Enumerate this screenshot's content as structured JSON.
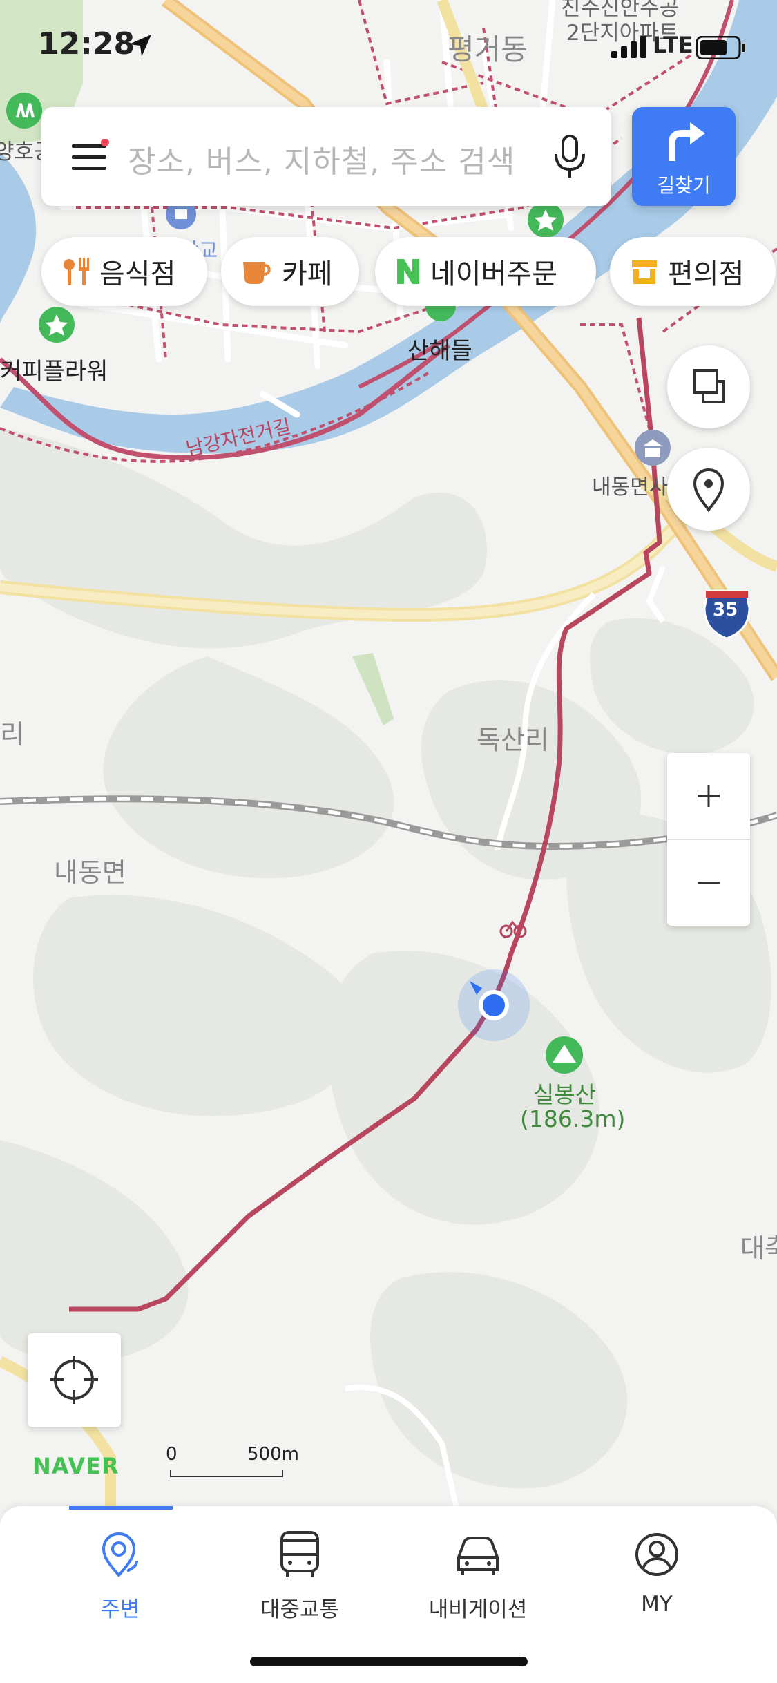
{
  "status": {
    "time": "12:28",
    "network": "LTE"
  },
  "search": {
    "placeholder": "장소, 버스, 지하철, 주소 검색"
  },
  "route_button": {
    "label": "길찾기"
  },
  "chips": [
    {
      "label": "음식점",
      "icon": "fork-knife-icon",
      "color": "#e8863a"
    },
    {
      "label": "카페",
      "icon": "coffee-cup-icon",
      "color": "#e8863a"
    },
    {
      "label": "네이버주문",
      "icon": "naver-n-icon",
      "color": "#46c154"
    },
    {
      "label": "편의점",
      "icon": "store-icon",
      "color": "#f2b01e"
    }
  ],
  "map": {
    "labels": {
      "pyeonggeo": "평거동",
      "apt1": "진주신안주공",
      "apt2": "2단지아파트",
      "park": "양호공",
      "coffee": "커피플라워",
      "sanhae": "산해들",
      "school": "학교",
      "bike_road": "남강자전거길",
      "naedong_office": "내동면사",
      "doksan": "독산리",
      "naedong": "내동면",
      "mountain": "실봉산",
      "mountain_height": "(186.3m)",
      "right_edge": "대축",
      "highway": "35",
      "left_edge": "리"
    },
    "colors": {
      "river": "#a9cbe8",
      "road_major": "#f5e3a3",
      "road_orange": "#efc27a",
      "bike_route": "#c0506e",
      "green": "#e4e9e1",
      "blue_dot": "#2f6ef0"
    }
  },
  "zoom": {
    "plus": "+",
    "minus": "−"
  },
  "brand": "NAVER",
  "scale": {
    "zero": "0",
    "distance": "500m"
  },
  "nav": {
    "tabs": [
      {
        "label": "주변",
        "icon": "location-pin-icon",
        "active": true
      },
      {
        "label": "대중교통",
        "icon": "bus-icon",
        "active": false
      },
      {
        "label": "내비게이션",
        "icon": "car-icon",
        "active": false
      },
      {
        "label": "MY",
        "icon": "user-circle-icon",
        "active": false
      }
    ]
  }
}
